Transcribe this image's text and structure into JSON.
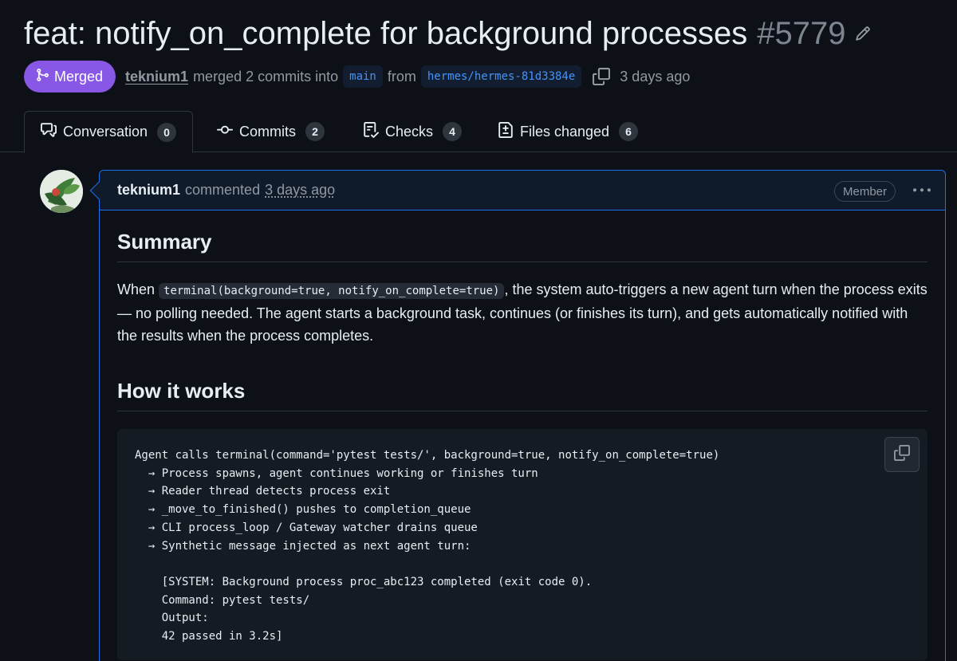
{
  "pr": {
    "title": "feat: notify_on_complete for background processes",
    "number": "#5779",
    "status": "Merged",
    "author": "teknium1",
    "merged_text": "merged 2 commits into",
    "base_branch": "main",
    "from_text": "from",
    "head_branch": "hermes/hermes-81d3384e",
    "time_ago": "3 days ago"
  },
  "tabs": [
    {
      "label": "Conversation",
      "count": "0",
      "icon": "comment-discussion-icon"
    },
    {
      "label": "Commits",
      "count": "2",
      "icon": "git-commit-icon"
    },
    {
      "label": "Checks",
      "count": "4",
      "icon": "checklist-icon"
    },
    {
      "label": "Files changed",
      "count": "6",
      "icon": "file-diff-icon"
    }
  ],
  "comment": {
    "author": "teknium1",
    "action": "commented",
    "time": "3 days ago",
    "badge": "Member",
    "heading1": "Summary",
    "p_before": "When ",
    "inline_code": "terminal(background=true, notify_on_complete=true)",
    "p_after": ", the system auto-triggers a new agent turn when the process exits — no polling needed. The agent starts a background task, continues (or finishes its turn), and gets automatically notified with the results when the process completes.",
    "heading2": "How it works",
    "code": "Agent calls terminal(command='pytest tests/', background=true, notify_on_complete=true)\n  → Process spawns, agent continues working or finishes turn\n  → Reader thread detects process exit\n  → _move_to_finished() pushes to completion_queue\n  → CLI process_loop / Gateway watcher drains queue\n  → Synthetic message injected as next agent turn:\n\n    [SYSTEM: Background process proc_abc123 completed (exit code 0).\n    Command: pytest tests/\n    Output:\n    42 passed in 3.2s]"
  },
  "colors": {
    "background": "#0d1117",
    "merged": "#8957e5",
    "link": "#4493f8",
    "border_accent": "#1f6feb"
  }
}
